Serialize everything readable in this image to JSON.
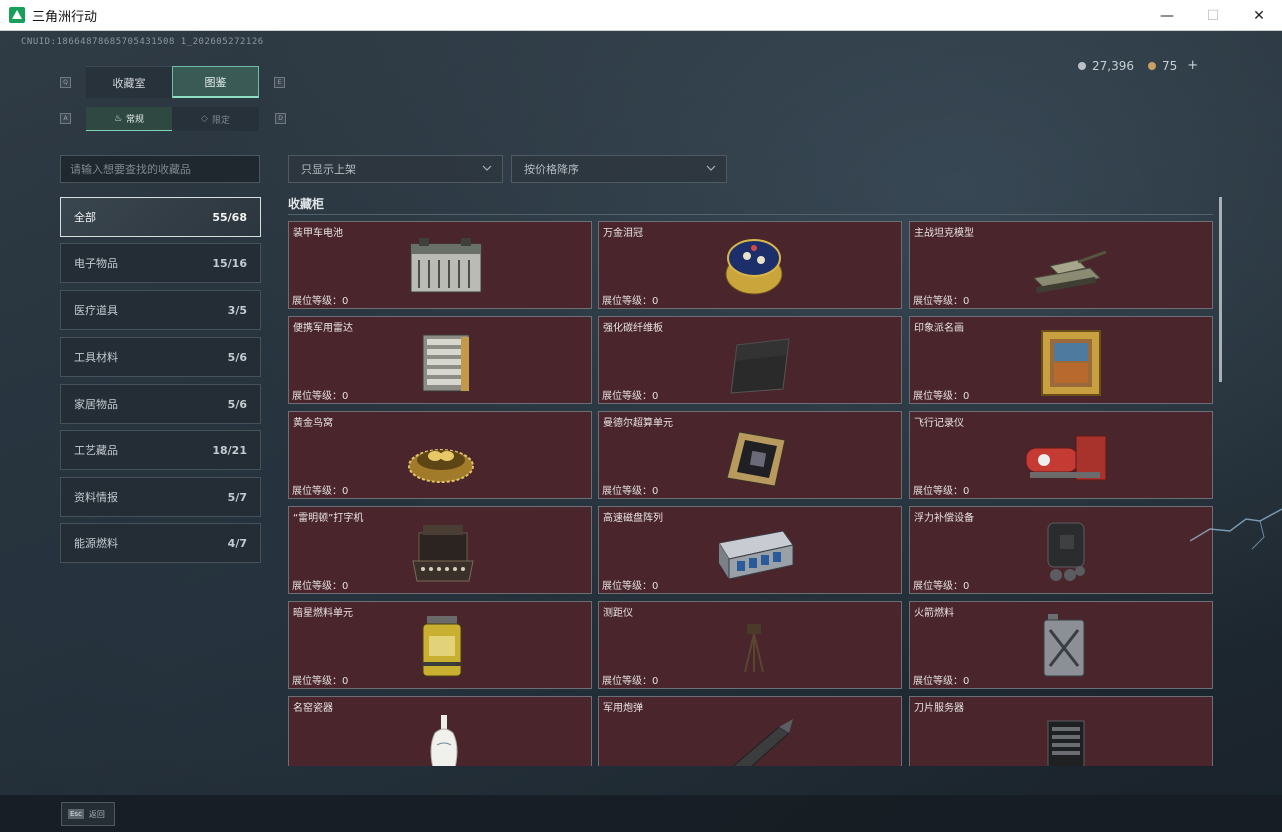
{
  "window": {
    "title": "三角洲行动",
    "minimize": "—",
    "maximize": "☐",
    "close": "✕"
  },
  "header": {
    "uid": "CNUID:18664878685705431508 1_202605272126",
    "silver": "27,396",
    "gold": "75",
    "plus": "+"
  },
  "tabs": {
    "left_key": "Q",
    "right_key": "E",
    "main": [
      "收藏室",
      "图鉴"
    ],
    "sub_left_key": "A",
    "sub_right_key": "D",
    "sub": [
      "常规",
      "限定"
    ]
  },
  "filters": {
    "search_placeholder": "请输入想要查找的收藏品",
    "shelf": "只显示上架",
    "sort": "按价格降序"
  },
  "categories": [
    {
      "name": "全部",
      "count": "55/68"
    },
    {
      "name": "电子物品",
      "count": "15/16"
    },
    {
      "name": "医疗道具",
      "count": "3/5"
    },
    {
      "name": "工具材料",
      "count": "5/6"
    },
    {
      "name": "家居物品",
      "count": "5/6"
    },
    {
      "name": "工艺藏品",
      "count": "18/21"
    },
    {
      "name": "资料情报",
      "count": "5/7"
    },
    {
      "name": "能源燃料",
      "count": "4/7"
    }
  ],
  "showcase": {
    "title": "收藏柜",
    "level_label": "展位等级：",
    "items": [
      {
        "name": "装甲车电池",
        "level": "0",
        "icon": "battery-icon"
      },
      {
        "name": "万金泪冠",
        "level": "0",
        "icon": "jeweled-egg-icon"
      },
      {
        "name": "主战坦克模型",
        "level": "0",
        "icon": "tank-model-icon"
      },
      {
        "name": "便携军用雷达",
        "level": "0",
        "icon": "radar-icon"
      },
      {
        "name": "强化碳纤维板",
        "level": "0",
        "icon": "carbon-plate-icon"
      },
      {
        "name": "印象派名画",
        "level": "0",
        "icon": "painting-icon"
      },
      {
        "name": "黄金鸟窝",
        "level": "0",
        "icon": "golden-nest-icon"
      },
      {
        "name": "曼德尔超算单元",
        "level": "0",
        "icon": "cpu-icon"
      },
      {
        "name": "飞行记录仪",
        "level": "0",
        "icon": "flight-recorder-icon"
      },
      {
        "name": "“雷明顿”打字机",
        "level": "0",
        "icon": "typewriter-icon"
      },
      {
        "name": "高速磁盘阵列",
        "level": "0",
        "icon": "disk-array-icon"
      },
      {
        "name": "浮力补偿设备",
        "level": "0",
        "icon": "buoyancy-device-icon"
      },
      {
        "name": "暗星燃料单元",
        "level": "0",
        "icon": "fuel-cell-icon"
      },
      {
        "name": "测距仪",
        "level": "0",
        "icon": "rangefinder-icon"
      },
      {
        "name": "火箭燃料",
        "level": "0",
        "icon": "rocket-fuel-icon"
      },
      {
        "name": "名窑瓷器",
        "level": "",
        "icon": "porcelain-vase-icon"
      },
      {
        "name": "军用炮弹",
        "level": "",
        "icon": "artillery-shell-icon"
      },
      {
        "name": "刀片服务器",
        "level": "",
        "icon": "blade-server-icon"
      }
    ]
  },
  "footer": {
    "esc_key": "Esc",
    "esc_label": "返回"
  },
  "colors": {
    "card_bg": "#4a252c",
    "accent": "#8fe0c2"
  }
}
